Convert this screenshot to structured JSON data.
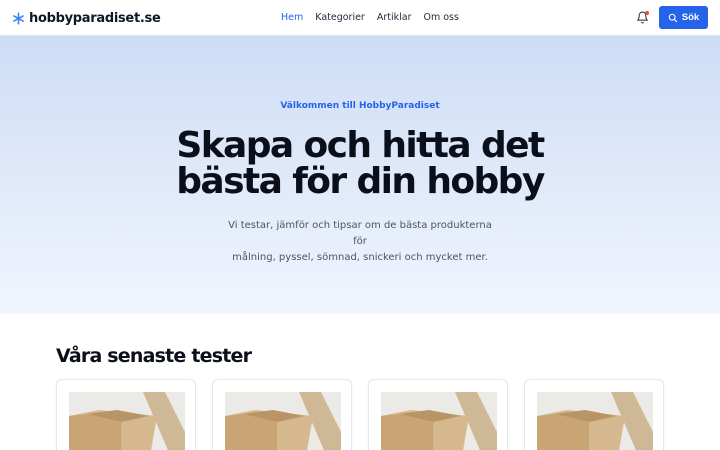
{
  "header": {
    "logo_text": "hobbyparadiset.se",
    "nav": [
      {
        "label": "Hem",
        "active": true
      },
      {
        "label": "Kategorier",
        "active": false
      },
      {
        "label": "Artiklar",
        "active": false
      },
      {
        "label": "Om oss",
        "active": false
      }
    ],
    "notification_icon": "bell-icon",
    "search_label": "Sök",
    "accent_color": "#2563eb"
  },
  "hero": {
    "eyebrow": "Välkommen till HobbyParadiset",
    "title_line1": "Skapa och hitta det",
    "title_line2": "bästa för din hobby",
    "subtitle_line1": "Vi testar, jämför och tipsar om de bästa produkterna för",
    "subtitle_line2": "målning, pyssel, sömnad, snickeri och mycket mer."
  },
  "tests": {
    "title": "Våra senaste tester",
    "cards": [
      {
        "image": "cardboard-box-image"
      },
      {
        "image": "cardboard-box-image"
      },
      {
        "image": "cardboard-box-image"
      },
      {
        "image": "cardboard-box-image"
      }
    ]
  }
}
